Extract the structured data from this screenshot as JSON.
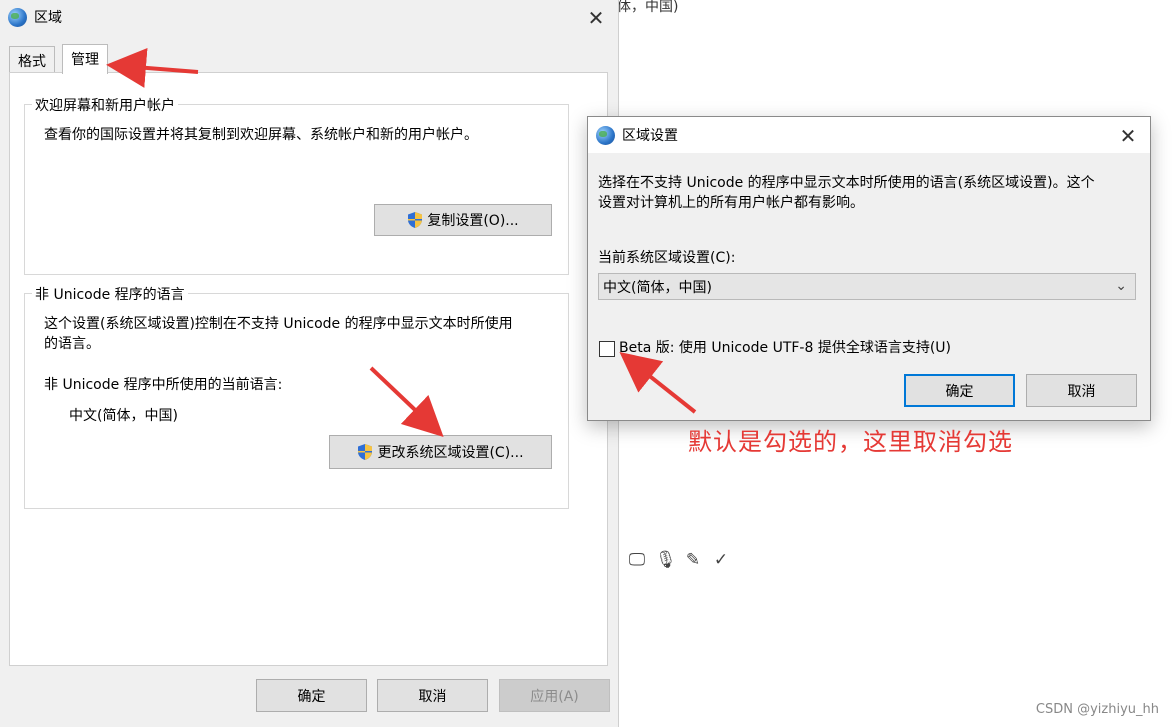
{
  "background": {
    "top_text": "体，中国)",
    "icons": [
      "monitor-icon",
      "microphone-icon",
      "edit-icon",
      "spellcheck-icon"
    ],
    "watermark": "CSDN @yizhiyu_hh"
  },
  "region_dialog": {
    "title": "区域",
    "tabs": [
      {
        "label": "格式"
      },
      {
        "label": "管理"
      }
    ],
    "welcome_group": {
      "title": "欢迎屏幕和新用户帐户",
      "description": "查看你的国际设置并将其复制到欢迎屏幕、系统帐户和新的用户帐户。",
      "copy_button": "复制设置(O)..."
    },
    "unicode_group": {
      "title": "非 Unicode 程序的语言",
      "description_line1": "这个设置(系统区域设置)控制在不支持 Unicode 的程序中显示文本时所使用",
      "description_line2": "的语言。",
      "current_label": "非 Unicode 程序中所使用的当前语言:",
      "current_value": "中文(简体，中国)",
      "change_button": "更改系统区域设置(C)..."
    },
    "buttons": {
      "ok": "确定",
      "cancel": "取消",
      "apply": "应用(A)"
    }
  },
  "locale_dialog": {
    "title": "区域设置",
    "description_line1": "选择在不支持 Unicode 的程序中显示文本时所使用的语言(系统区域设置)。这个",
    "description_line2": "设置对计算机上的所有用户帐户都有影响。",
    "current_label": "当前系统区域设置(C):",
    "current_value": "中文(简体，中国)",
    "beta_label": "Beta 版: 使用 Unicode UTF-8 提供全球语言支持(U)",
    "beta_checked": false,
    "ok": "确定",
    "cancel": "取消"
  },
  "annotation": {
    "text": "默认是勾选的，这里取消勾选",
    "color": "#e53935"
  },
  "colors": {
    "accent": "#0078d7",
    "window_bg": "#f0f0f0",
    "shield_blue": "#2f6fd6",
    "shield_yellow": "#f6c342"
  }
}
